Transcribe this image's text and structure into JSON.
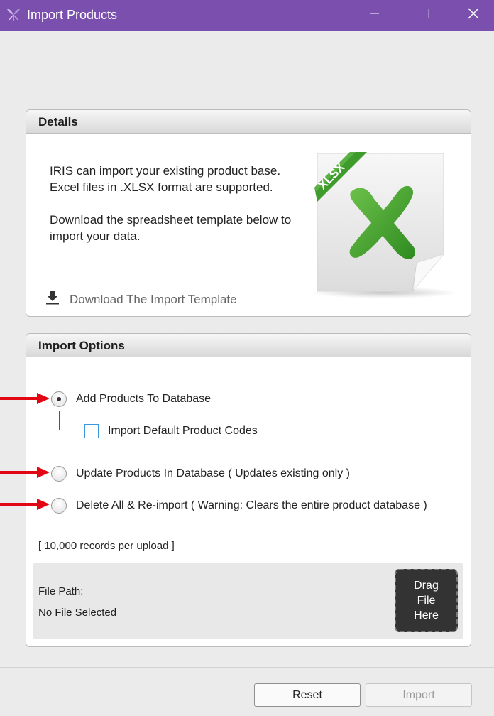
{
  "window": {
    "title": "Import Products",
    "icons": {
      "app": "iris-flower-icon",
      "minimize": "minimize-icon",
      "maximize": "maximize-icon",
      "close": "close-icon"
    },
    "titlebar_color": "#7a4fad"
  },
  "details": {
    "header": "Details",
    "line1": "IRIS can import your existing product base.",
    "line2": "Excel files in .XLSX format are supported.",
    "line3": "Download the spreadsheet template below to",
    "line4": "import your data.",
    "download_label": "Download The Import Template",
    "download_icon": "download-icon",
    "file_badge": "XLSX",
    "file_icon": "xlsx-file-icon"
  },
  "import_options": {
    "header": "Import Options",
    "options": [
      {
        "label": "Add Products To Database",
        "selected": true
      },
      {
        "label": "Update Products In Database ( Updates existing only )",
        "selected": false
      },
      {
        "label": "Delete All & Re-import ( Warning: Clears the entire product database )",
        "selected": false
      }
    ],
    "sub_option": {
      "label": "Import Default Product Codes",
      "checked": false
    },
    "records_note": "[ 10,000 records per upload ]",
    "file_path_label": "File Path:",
    "file_path_value": "No File Selected",
    "drop_zone": {
      "line1": "Drag",
      "line2": "File",
      "line3": "Here"
    }
  },
  "buttons": {
    "reset": "Reset",
    "import": "Import",
    "import_enabled": false
  },
  "annotations": {
    "arrow_color": "#e30613",
    "arrow_icon": "red-arrow-icon"
  }
}
